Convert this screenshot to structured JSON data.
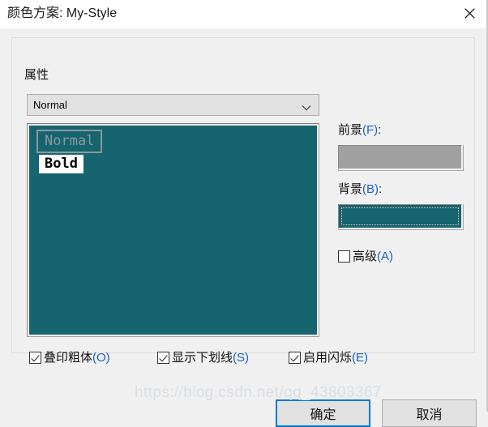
{
  "window": {
    "title": "颜色方案: My-Style",
    "close_icon": "close-icon"
  },
  "groupbox": {
    "label": "属性"
  },
  "combo": {
    "value": "Normal",
    "arrow_icon": "chevron-down-icon",
    "options": [
      "Normal"
    ]
  },
  "preview": {
    "background_color": "#15646F",
    "samples": [
      {
        "text": "Normal",
        "color": "#8a9a9a",
        "background": "transparent",
        "bold": false,
        "boxed": true
      },
      {
        "text": "Bold",
        "color": "#000000",
        "background": "#ffffff",
        "bold": true,
        "boxed": false
      }
    ]
  },
  "colors": {
    "foreground": {
      "label_prefix": "前景",
      "label_accel": "(F)",
      "label_suffix": ":",
      "swatch_color": "#a0a0a0"
    },
    "background": {
      "label_prefix": "背景",
      "label_accel": "(B)",
      "label_suffix": ":",
      "swatch_color": "#15646F",
      "focused": true
    }
  },
  "checkboxes": {
    "advanced": {
      "prefix": "高级",
      "accel": "(A)",
      "checked": false
    },
    "bold_overstrike": {
      "prefix": "叠印粗体",
      "accel": "(O)",
      "checked": true
    },
    "show_underline": {
      "prefix": "显示下划线",
      "accel": "(S)",
      "checked": true
    },
    "enable_blink": {
      "prefix": "启用闪烁",
      "accel": "(E)",
      "checked": true
    }
  },
  "buttons": {
    "ok": "确定",
    "cancel": "取消"
  },
  "watermark": {
    "text": "https://blog.csdn.net/qq_43803367"
  }
}
